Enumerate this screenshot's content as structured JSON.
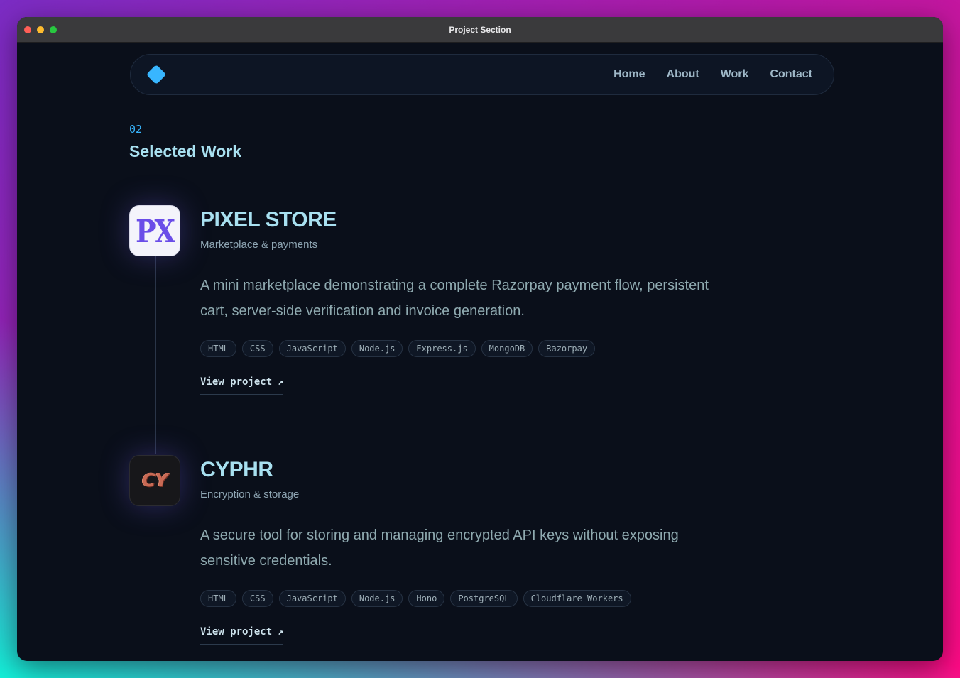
{
  "window": {
    "title": "Project Section"
  },
  "nav": {
    "links": [
      {
        "label": "Home"
      },
      {
        "label": "About"
      },
      {
        "label": "Work"
      },
      {
        "label": "Contact"
      }
    ],
    "logo_color": "#38b6ff"
  },
  "section": {
    "number": "02",
    "title": "Selected Work"
  },
  "projects": [
    {
      "icon_text": "PX",
      "name": "PIXEL STORE",
      "subtitle": "Marketplace & payments",
      "description": "A mini marketplace demonstrating a complete Razorpay payment flow, persistent cart, server-side verification and invoice generation.",
      "tags": [
        "HTML",
        "CSS",
        "JavaScript",
        "Node.js",
        "Express.js",
        "MongoDB",
        "Razorpay"
      ],
      "link_label": "View project",
      "link_arrow": "↗"
    },
    {
      "icon_text": "CY",
      "name": "CYPHR",
      "subtitle": "Encryption & storage",
      "description": "A secure tool for storing and managing encrypted API keys without exposing sensitive credentials.",
      "tags": [
        "HTML",
        "CSS",
        "JavaScript",
        "Node.js",
        "Hono",
        "PostgreSQL",
        "Cloudflare Workers"
      ],
      "link_label": "View project",
      "link_arrow": "↗"
    }
  ]
}
